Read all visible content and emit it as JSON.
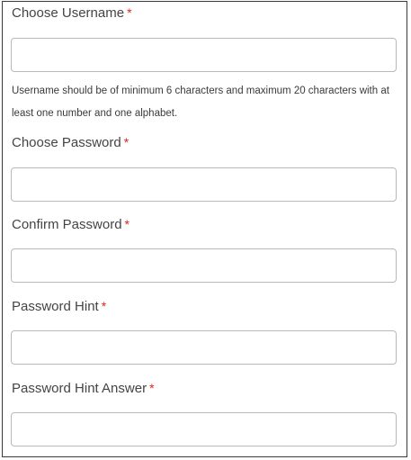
{
  "form": {
    "username": {
      "label": "Choose Username",
      "required_marker": "*",
      "value": "",
      "help_text": "Username should be of minimum 6 characters and maximum 20 characters with at least one number and one alphabet."
    },
    "password": {
      "label": "Choose Password",
      "required_marker": "*",
      "value": ""
    },
    "confirm_password": {
      "label": "Confirm Password",
      "required_marker": "*",
      "value": ""
    },
    "password_hint": {
      "label": "Password Hint",
      "required_marker": "*",
      "value": ""
    },
    "password_hint_answer": {
      "label": "Password Hint Answer",
      "required_marker": "*",
      "value": ""
    }
  },
  "colors": {
    "required_marker": "#e0261a",
    "field_border": "#b9b9b9",
    "panel_border": "#3a3a3a"
  }
}
